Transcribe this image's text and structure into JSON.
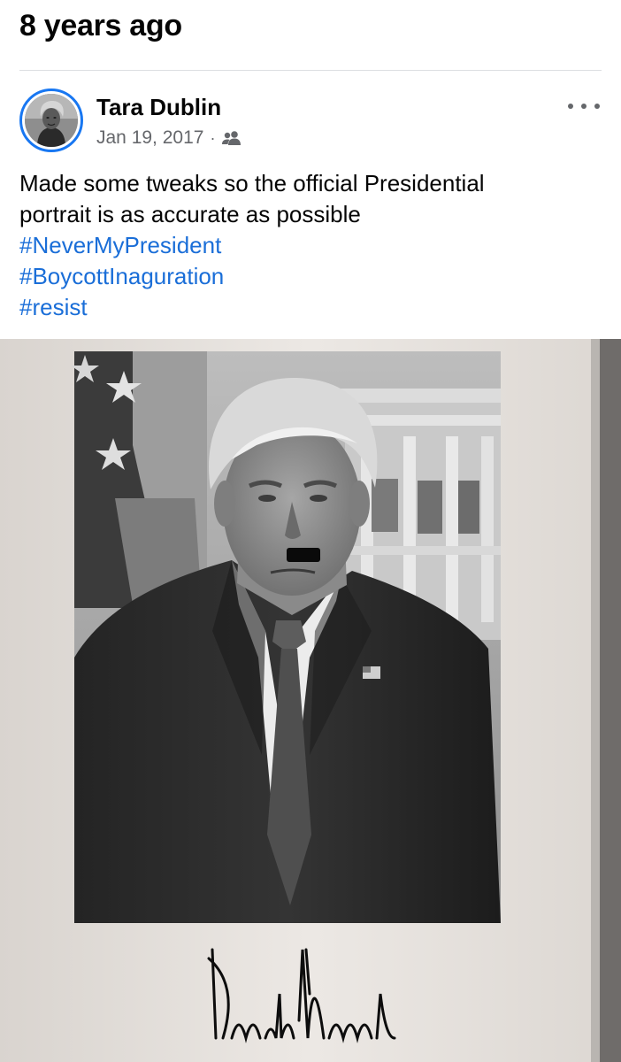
{
  "memory": {
    "header_cut_text": "",
    "title": "8 years ago"
  },
  "post": {
    "author": "Tara Dublin",
    "date": "Jan 19, 2017",
    "separator": "·",
    "audience_icon": "friends-icon",
    "more_icon": "more-options-icon",
    "text_lines": [
      "Made some tweaks so the official Presidential",
      "portrait is as accurate as possible"
    ],
    "hashtags": [
      "#NeverMyPresident",
      "#BoycottInaguration",
      "#resist"
    ]
  },
  "colors": {
    "accent": "#1877f2",
    "hashtag": "#1a6ed8",
    "text_primary": "#050505",
    "text_secondary": "#65676b",
    "divider": "#dddfe2"
  }
}
